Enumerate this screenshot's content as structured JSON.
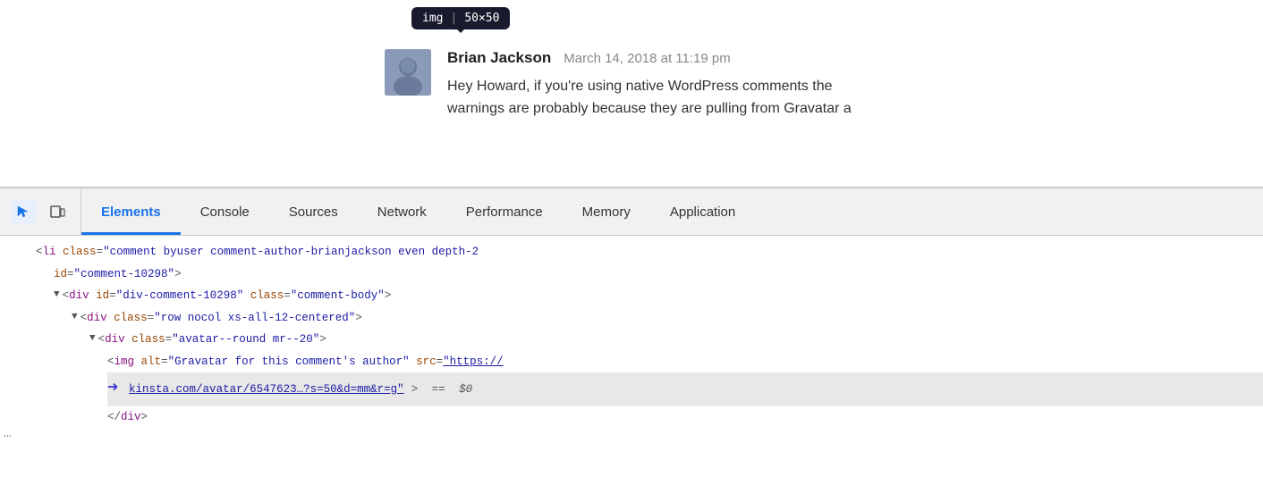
{
  "tooltip": {
    "tag": "img",
    "dimensions": "50×50"
  },
  "comment": {
    "author": "Brian Jackson",
    "date": "March 14, 2018 at 11:19 pm",
    "text_line1": "Hey Howard, if you're using native WordPress comments the",
    "text_line2": "warnings are probably because they are pulling from Gravatar a"
  },
  "devtools": {
    "tabs": [
      {
        "id": "elements",
        "label": "Elements",
        "active": true
      },
      {
        "id": "console",
        "label": "Console",
        "active": false
      },
      {
        "id": "sources",
        "label": "Sources",
        "active": false
      },
      {
        "id": "network",
        "label": "Network",
        "active": false
      },
      {
        "id": "performance",
        "label": "Performance",
        "active": false
      },
      {
        "id": "memory",
        "label": "Memory",
        "active": false
      },
      {
        "id": "application",
        "label": "Application",
        "active": false
      }
    ]
  },
  "dom": {
    "line1_part1": "<li class=",
    "line1_part2": "\"comment byuser comment-author-brianjackson even depth-2",
    "line1_part3": "\"",
    "line1_end": "",
    "line2_attr": "id=",
    "line2_val": "\"comment-10298\"",
    "line2_end": ">",
    "line3_tag": "div",
    "line3_attr1": "id=",
    "line3_val1": "\"div-comment-10298\"",
    "line3_attr2": "class=",
    "line3_val2": "\"comment-body\"",
    "line4_tag": "div",
    "line4_attr": "class=",
    "line4_val": "\"row nocol xs-all-12-centered\"",
    "line5_tag": "div",
    "line5_attr": "class=",
    "line5_val": "\"avatar--round mr--20\"",
    "line6_tag": "img",
    "line6_attr1": "alt=",
    "line6_val1": "\"Gravatar for this comment's author\"",
    "line6_attr2": "src=",
    "line6_val2": "\"https://",
    "line7_url": "kinsta.com/avatar/6547623…?s=50&d=mm&r=g\"",
    "line7_end": "> == $0",
    "line8_close": "</div>"
  }
}
